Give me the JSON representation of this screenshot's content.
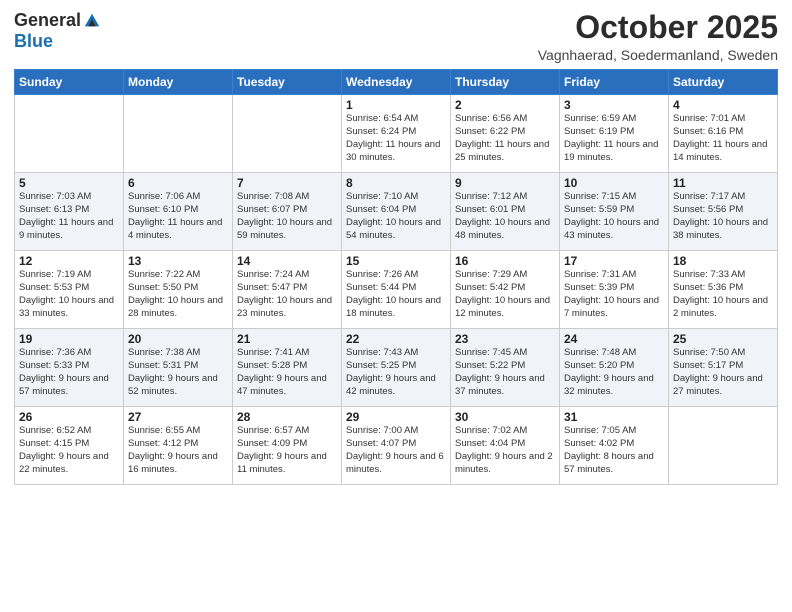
{
  "header": {
    "logo_general": "General",
    "logo_blue": "Blue",
    "month_title": "October 2025",
    "location": "Vagnhaerad, Soedermanland, Sweden"
  },
  "weekdays": [
    "Sunday",
    "Monday",
    "Tuesday",
    "Wednesday",
    "Thursday",
    "Friday",
    "Saturday"
  ],
  "weeks": [
    [
      {
        "day": "",
        "sunrise": "",
        "sunset": "",
        "daylight": ""
      },
      {
        "day": "",
        "sunrise": "",
        "sunset": "",
        "daylight": ""
      },
      {
        "day": "",
        "sunrise": "",
        "sunset": "",
        "daylight": ""
      },
      {
        "day": "1",
        "sunrise": "Sunrise: 6:54 AM",
        "sunset": "Sunset: 6:24 PM",
        "daylight": "Daylight: 11 hours and 30 minutes."
      },
      {
        "day": "2",
        "sunrise": "Sunrise: 6:56 AM",
        "sunset": "Sunset: 6:22 PM",
        "daylight": "Daylight: 11 hours and 25 minutes."
      },
      {
        "day": "3",
        "sunrise": "Sunrise: 6:59 AM",
        "sunset": "Sunset: 6:19 PM",
        "daylight": "Daylight: 11 hours and 19 minutes."
      },
      {
        "day": "4",
        "sunrise": "Sunrise: 7:01 AM",
        "sunset": "Sunset: 6:16 PM",
        "daylight": "Daylight: 11 hours and 14 minutes."
      }
    ],
    [
      {
        "day": "5",
        "sunrise": "Sunrise: 7:03 AM",
        "sunset": "Sunset: 6:13 PM",
        "daylight": "Daylight: 11 hours and 9 minutes."
      },
      {
        "day": "6",
        "sunrise": "Sunrise: 7:06 AM",
        "sunset": "Sunset: 6:10 PM",
        "daylight": "Daylight: 11 hours and 4 minutes."
      },
      {
        "day": "7",
        "sunrise": "Sunrise: 7:08 AM",
        "sunset": "Sunset: 6:07 PM",
        "daylight": "Daylight: 10 hours and 59 minutes."
      },
      {
        "day": "8",
        "sunrise": "Sunrise: 7:10 AM",
        "sunset": "Sunset: 6:04 PM",
        "daylight": "Daylight: 10 hours and 54 minutes."
      },
      {
        "day": "9",
        "sunrise": "Sunrise: 7:12 AM",
        "sunset": "Sunset: 6:01 PM",
        "daylight": "Daylight: 10 hours and 48 minutes."
      },
      {
        "day": "10",
        "sunrise": "Sunrise: 7:15 AM",
        "sunset": "Sunset: 5:59 PM",
        "daylight": "Daylight: 10 hours and 43 minutes."
      },
      {
        "day": "11",
        "sunrise": "Sunrise: 7:17 AM",
        "sunset": "Sunset: 5:56 PM",
        "daylight": "Daylight: 10 hours and 38 minutes."
      }
    ],
    [
      {
        "day": "12",
        "sunrise": "Sunrise: 7:19 AM",
        "sunset": "Sunset: 5:53 PM",
        "daylight": "Daylight: 10 hours and 33 minutes."
      },
      {
        "day": "13",
        "sunrise": "Sunrise: 7:22 AM",
        "sunset": "Sunset: 5:50 PM",
        "daylight": "Daylight: 10 hours and 28 minutes."
      },
      {
        "day": "14",
        "sunrise": "Sunrise: 7:24 AM",
        "sunset": "Sunset: 5:47 PM",
        "daylight": "Daylight: 10 hours and 23 minutes."
      },
      {
        "day": "15",
        "sunrise": "Sunrise: 7:26 AM",
        "sunset": "Sunset: 5:44 PM",
        "daylight": "Daylight: 10 hours and 18 minutes."
      },
      {
        "day": "16",
        "sunrise": "Sunrise: 7:29 AM",
        "sunset": "Sunset: 5:42 PM",
        "daylight": "Daylight: 10 hours and 12 minutes."
      },
      {
        "day": "17",
        "sunrise": "Sunrise: 7:31 AM",
        "sunset": "Sunset: 5:39 PM",
        "daylight": "Daylight: 10 hours and 7 minutes."
      },
      {
        "day": "18",
        "sunrise": "Sunrise: 7:33 AM",
        "sunset": "Sunset: 5:36 PM",
        "daylight": "Daylight: 10 hours and 2 minutes."
      }
    ],
    [
      {
        "day": "19",
        "sunrise": "Sunrise: 7:36 AM",
        "sunset": "Sunset: 5:33 PM",
        "daylight": "Daylight: 9 hours and 57 minutes."
      },
      {
        "day": "20",
        "sunrise": "Sunrise: 7:38 AM",
        "sunset": "Sunset: 5:31 PM",
        "daylight": "Daylight: 9 hours and 52 minutes."
      },
      {
        "day": "21",
        "sunrise": "Sunrise: 7:41 AM",
        "sunset": "Sunset: 5:28 PM",
        "daylight": "Daylight: 9 hours and 47 minutes."
      },
      {
        "day": "22",
        "sunrise": "Sunrise: 7:43 AM",
        "sunset": "Sunset: 5:25 PM",
        "daylight": "Daylight: 9 hours and 42 minutes."
      },
      {
        "day": "23",
        "sunrise": "Sunrise: 7:45 AM",
        "sunset": "Sunset: 5:22 PM",
        "daylight": "Daylight: 9 hours and 37 minutes."
      },
      {
        "day": "24",
        "sunrise": "Sunrise: 7:48 AM",
        "sunset": "Sunset: 5:20 PM",
        "daylight": "Daylight: 9 hours and 32 minutes."
      },
      {
        "day": "25",
        "sunrise": "Sunrise: 7:50 AM",
        "sunset": "Sunset: 5:17 PM",
        "daylight": "Daylight: 9 hours and 27 minutes."
      }
    ],
    [
      {
        "day": "26",
        "sunrise": "Sunrise: 6:52 AM",
        "sunset": "Sunset: 4:15 PM",
        "daylight": "Daylight: 9 hours and 22 minutes."
      },
      {
        "day": "27",
        "sunrise": "Sunrise: 6:55 AM",
        "sunset": "Sunset: 4:12 PM",
        "daylight": "Daylight: 9 hours and 16 minutes."
      },
      {
        "day": "28",
        "sunrise": "Sunrise: 6:57 AM",
        "sunset": "Sunset: 4:09 PM",
        "daylight": "Daylight: 9 hours and 11 minutes."
      },
      {
        "day": "29",
        "sunrise": "Sunrise: 7:00 AM",
        "sunset": "Sunset: 4:07 PM",
        "daylight": "Daylight: 9 hours and 6 minutes."
      },
      {
        "day": "30",
        "sunrise": "Sunrise: 7:02 AM",
        "sunset": "Sunset: 4:04 PM",
        "daylight": "Daylight: 9 hours and 2 minutes."
      },
      {
        "day": "31",
        "sunrise": "Sunrise: 7:05 AM",
        "sunset": "Sunset: 4:02 PM",
        "daylight": "Daylight: 8 hours and 57 minutes."
      },
      {
        "day": "",
        "sunrise": "",
        "sunset": "",
        "daylight": ""
      }
    ]
  ]
}
